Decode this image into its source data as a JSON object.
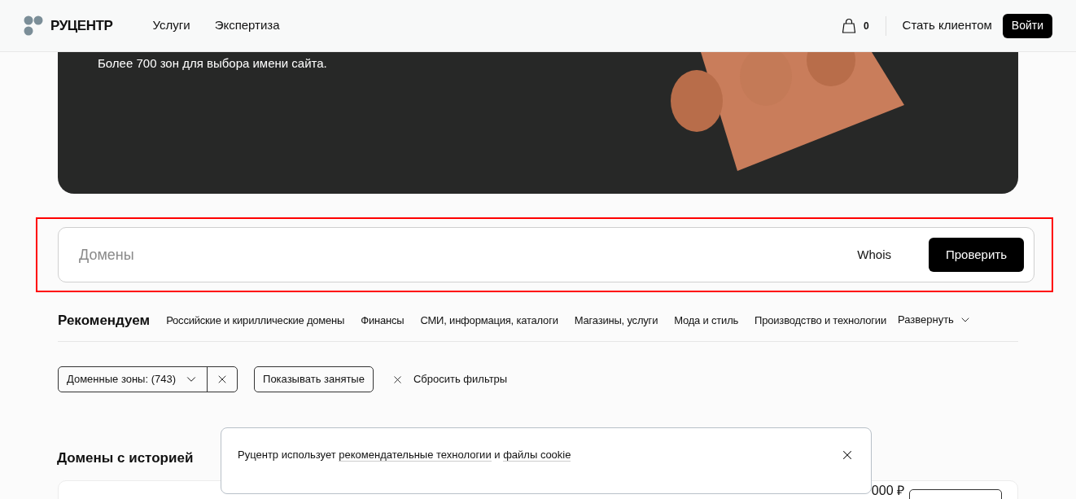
{
  "header": {
    "logo": "РУЦЕНТР",
    "nav": [
      "Услуги",
      "Экспертиза"
    ],
    "cart_count": "0",
    "become_client": "Стать клиентом",
    "login": "Войти"
  },
  "hero": {
    "subtitle": "Более 700 зон для выбора имени сайта."
  },
  "search": {
    "placeholder": "Домены",
    "whois": "Whois",
    "submit": "Проверить",
    "highlighted": true
  },
  "recommend": {
    "title": "Рекомендуем",
    "categories": [
      "Российские и кириллические домены",
      "Финансы",
      "СМИ, информация, каталоги",
      "Магазины, услуги",
      "Мода и стиль",
      "Производство и технологии"
    ],
    "expand": "Развернуть"
  },
  "filters": {
    "zones": "Доменные зоны: (743)",
    "show_taken": "Показывать занятые",
    "reset": "Сбросить фильтры"
  },
  "history": {
    "title": "Домены с историей",
    "price": "000 ₽"
  },
  "cookie": {
    "text_before": "Руцентр использует ",
    "link1": "рекомендательные технологии",
    "middle": " и ",
    "link2": "файлы cookie"
  }
}
